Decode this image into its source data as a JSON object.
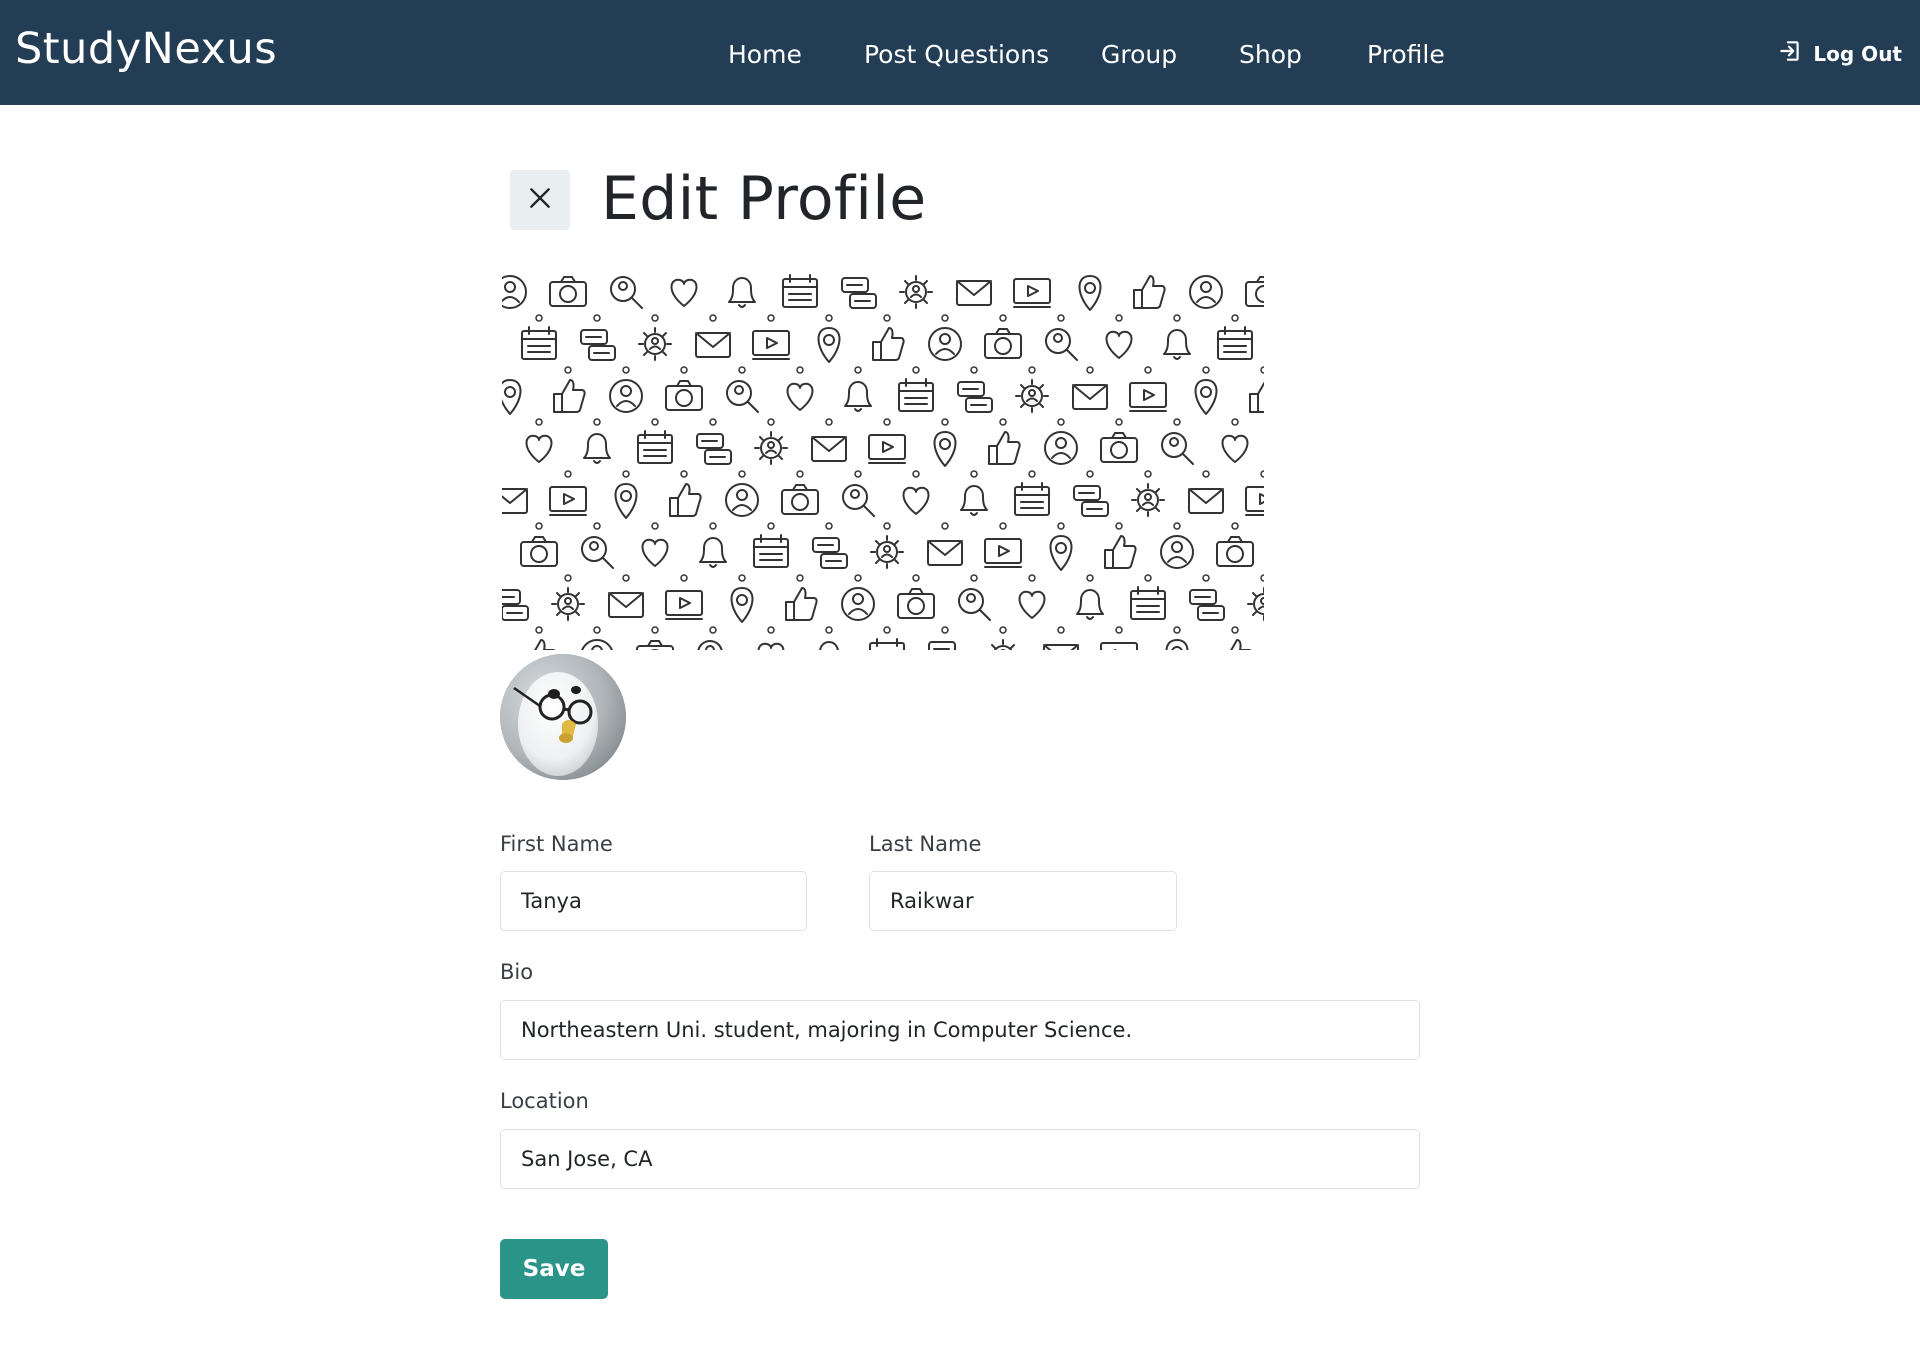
{
  "brand": "StudyNexus",
  "nav": {
    "items": [
      {
        "label": "Home"
      },
      {
        "label": "Post Questions"
      },
      {
        "label": "Group"
      },
      {
        "label": "Shop"
      },
      {
        "label": "Profile"
      }
    ],
    "logout_label": "Log Out",
    "logout_icon": "logout-icon"
  },
  "page": {
    "title": "Edit Profile",
    "close_icon": "close-icon"
  },
  "form": {
    "first_name": {
      "label": "First Name",
      "value": "Tanya"
    },
    "last_name": {
      "label": "Last Name",
      "value": "Raikwar"
    },
    "bio": {
      "label": "Bio",
      "value": "Northeastern Uni. student, majoring in Computer Science."
    },
    "location": {
      "label": "Location",
      "value": "San Jose, CA"
    },
    "save_label": "Save"
  },
  "colors": {
    "navbar": "#233d54",
    "save_button": "#2a9488",
    "close_button_bg": "#e9eef1"
  }
}
